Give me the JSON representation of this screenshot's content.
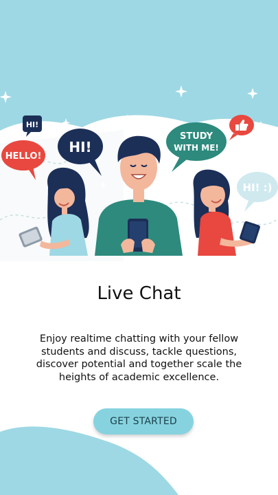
{
  "hero": {
    "bubbles": {
      "hello": "HELLO!",
      "hi_small": "HI!",
      "hi_center": "HI!",
      "study_line1": "STUDY",
      "study_line2": "WITH ME!",
      "hi_smile": "HI! :)"
    }
  },
  "onboarding": {
    "title": "Live Chat",
    "description": "Enjoy realtime chatting with your fellow students and discuss, tackle questions, discover potential and together scale the heights of academic excellence.",
    "cta_label": "GET STARTED"
  },
  "colors": {
    "accent": "#86d3df",
    "sky": "#9ed8e4",
    "red": "#e8483f",
    "navy": "#1c2f57",
    "teal": "#2d8a7d"
  }
}
